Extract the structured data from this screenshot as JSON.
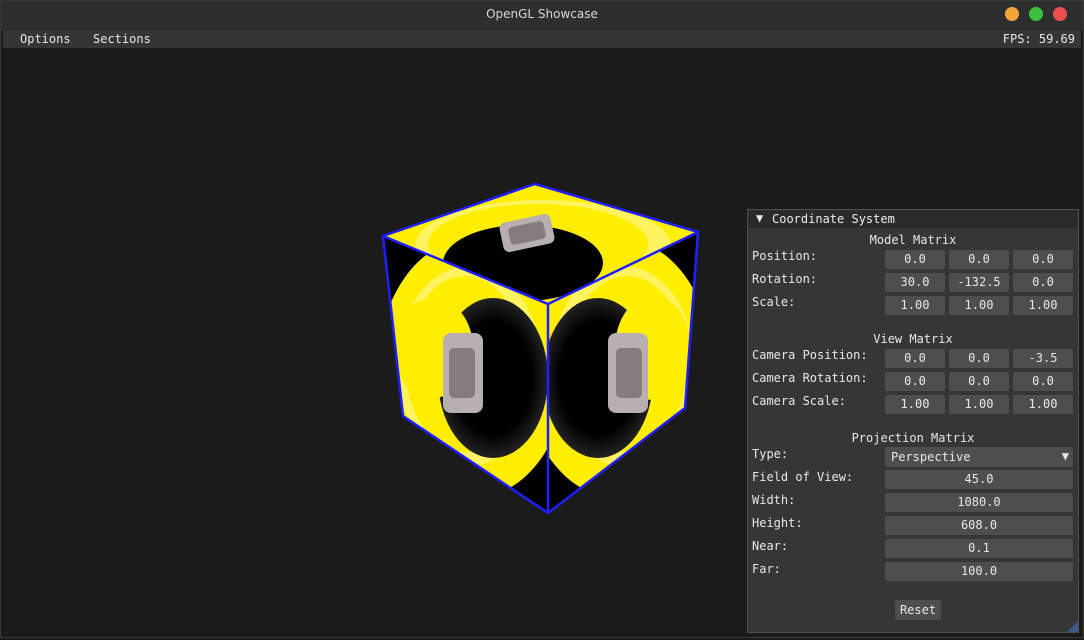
{
  "window": {
    "title": "OpenGL Showcase",
    "controls": [
      {
        "name": "minimize",
        "color": "#f4a53a"
      },
      {
        "name": "maximize",
        "color": "#3fbf3f"
      },
      {
        "name": "close",
        "color": "#e9504a"
      }
    ]
  },
  "menubar": {
    "items": [
      "Options",
      "Sections"
    ],
    "fps": "FPS: 59.69"
  },
  "scene": {
    "cube_edge_color": "#1f1fff",
    "texture_primary": "#ffee00",
    "texture_secondary": "#000000"
  },
  "panel": {
    "title": "Coordinate System",
    "model": {
      "title": "Model Matrix",
      "rows": [
        {
          "label": "Position:",
          "values": [
            "0.0",
            "0.0",
            "0.0"
          ]
        },
        {
          "label": "Rotation:",
          "values": [
            "30.0",
            "-132.5",
            "0.0"
          ]
        },
        {
          "label": "Scale:",
          "values": [
            "1.00",
            "1.00",
            "1.00"
          ]
        }
      ]
    },
    "view": {
      "title": "View Matrix",
      "rows": [
        {
          "label": "Camera Position:",
          "values": [
            "0.0",
            "0.0",
            "-3.5"
          ]
        },
        {
          "label": "Camera Rotation:",
          "values": [
            "0.0",
            "0.0",
            "0.0"
          ]
        },
        {
          "label": "Camera Scale:",
          "values": [
            "1.00",
            "1.00",
            "1.00"
          ]
        }
      ]
    },
    "projection": {
      "title": "Projection Matrix",
      "type_label": "Type:",
      "type_value": "Perspective",
      "rows": [
        {
          "label": "Field of View:",
          "value": "45.0"
        },
        {
          "label": "Width:",
          "value": "1080.0"
        },
        {
          "label": "Height:",
          "value": "608.0"
        },
        {
          "label": "Near:",
          "value": "0.1"
        },
        {
          "label": "Far:",
          "value": "100.0"
        }
      ]
    },
    "reset_label": "Reset"
  }
}
